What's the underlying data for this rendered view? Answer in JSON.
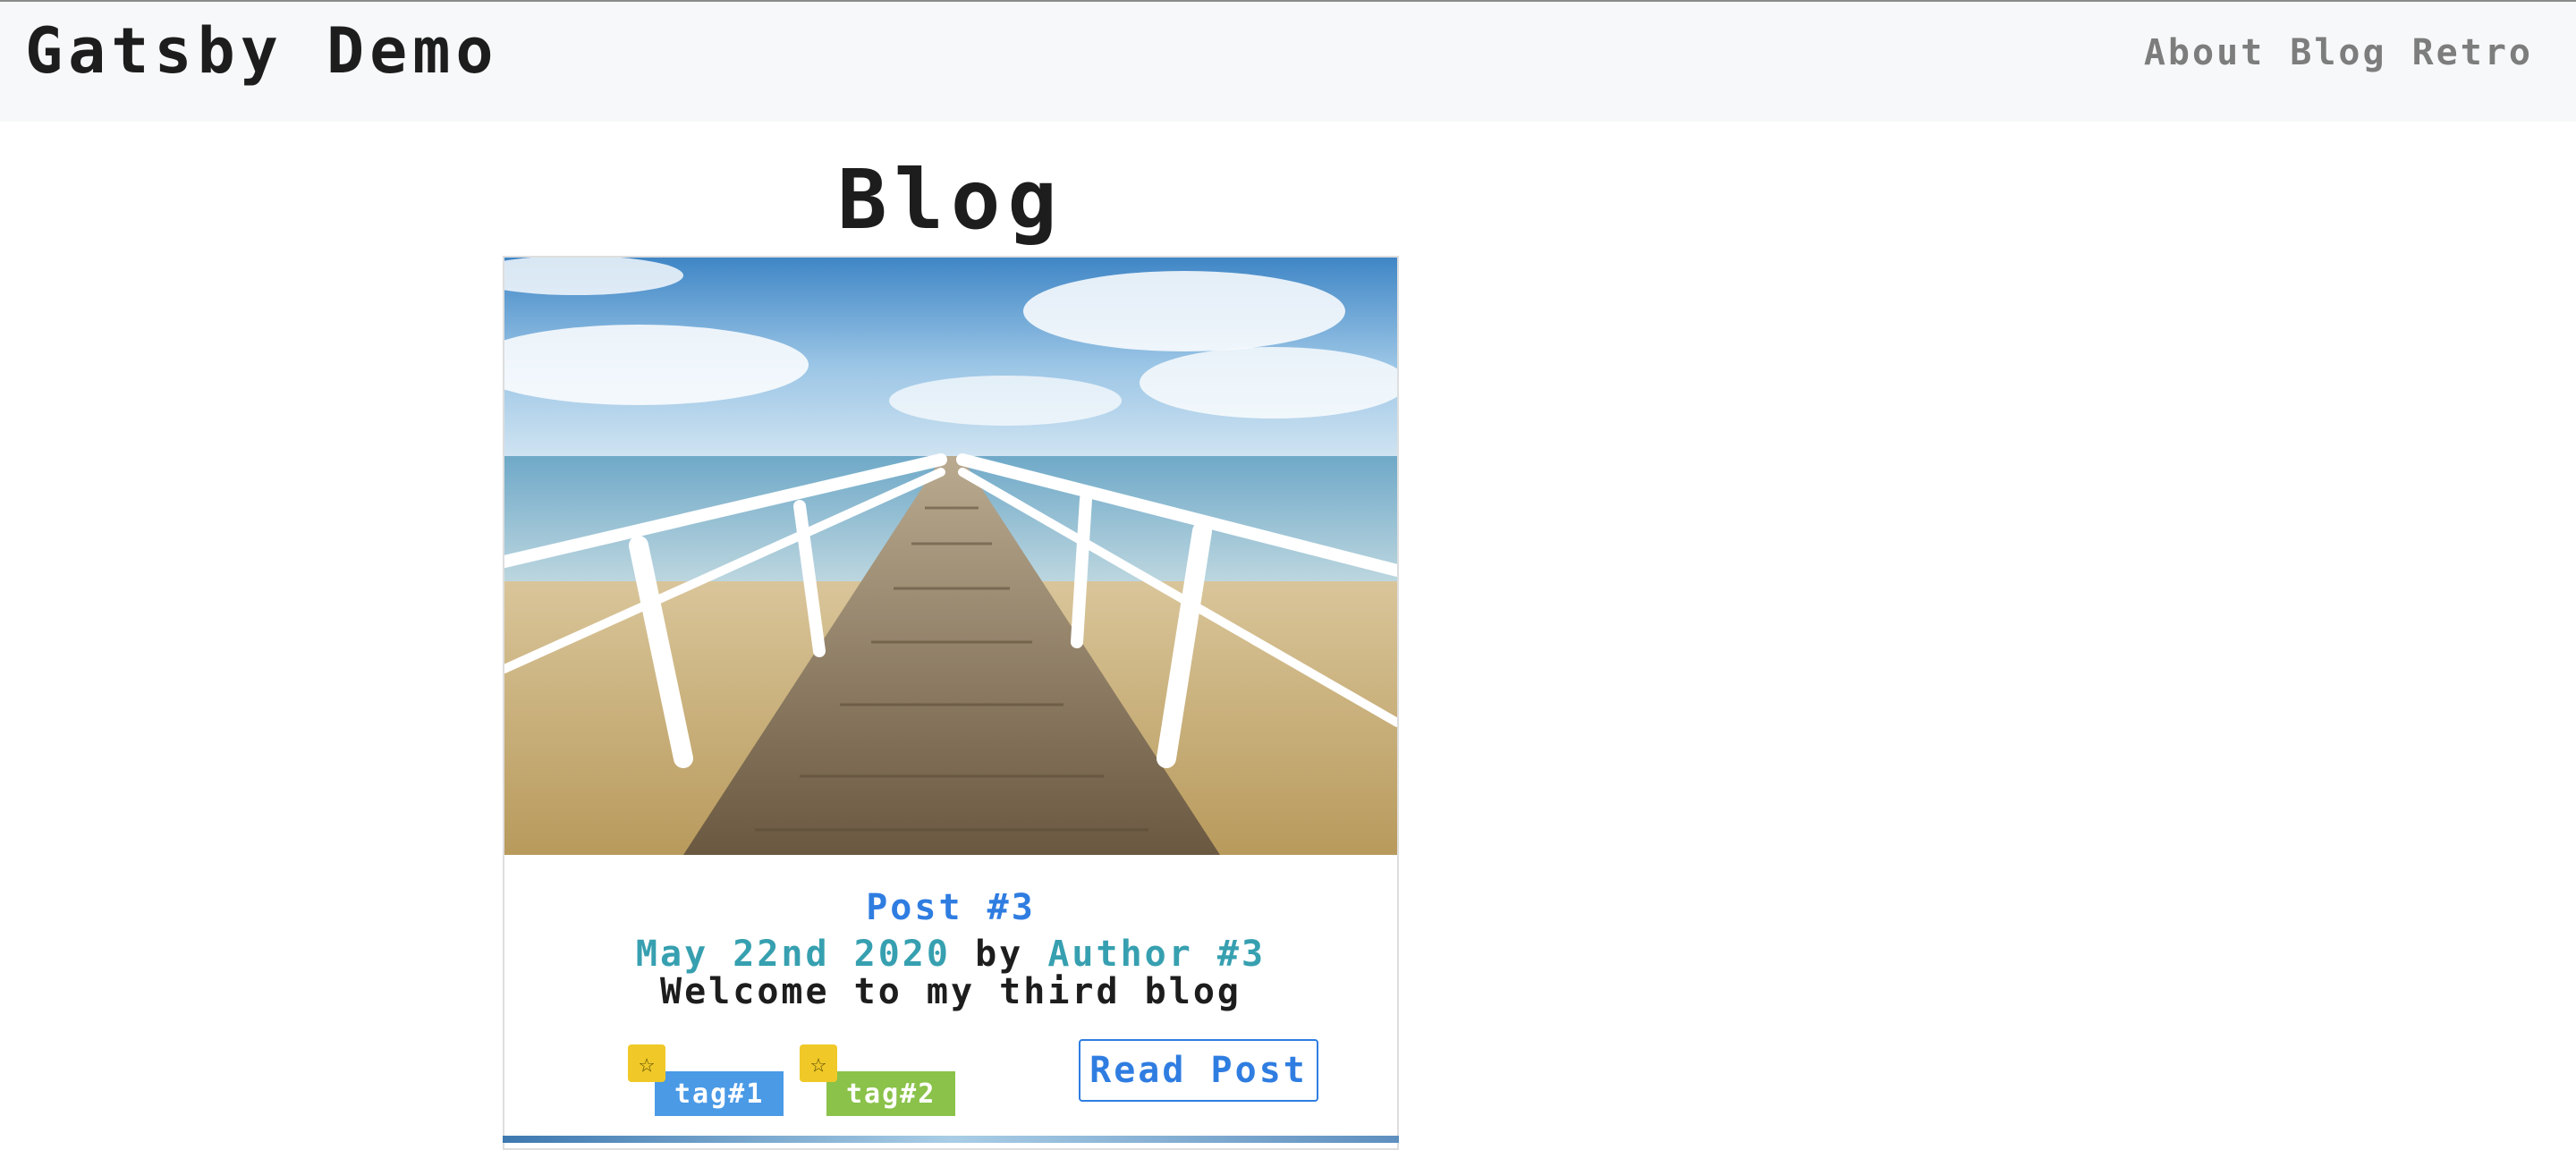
{
  "header": {
    "brand": "Gatsby Demo",
    "nav": [
      {
        "label": "About"
      },
      {
        "label": "Blog"
      },
      {
        "label": "Retro"
      }
    ]
  },
  "main": {
    "title": "Blog",
    "posts": [
      {
        "title": "Post #3",
        "date": "May 22nd 2020",
        "by": "by",
        "author": "Author #3",
        "excerpt": "Welcome to my third blog",
        "tags": [
          {
            "label": "tag#1",
            "color": "#4a9ae6",
            "icon": "star-icon"
          },
          {
            "label": "tag#2",
            "color": "#8ac24a",
            "icon": "star-icon"
          }
        ],
        "read_label": "Read Post",
        "image": "pier-boardwalk-photo"
      }
    ]
  },
  "colors": {
    "link": "#2f7de1",
    "meta_link": "#37a0b0",
    "nav": "#7d7d7d",
    "header_bg": "#f7f8f9",
    "tag_star": "#f0c929"
  }
}
